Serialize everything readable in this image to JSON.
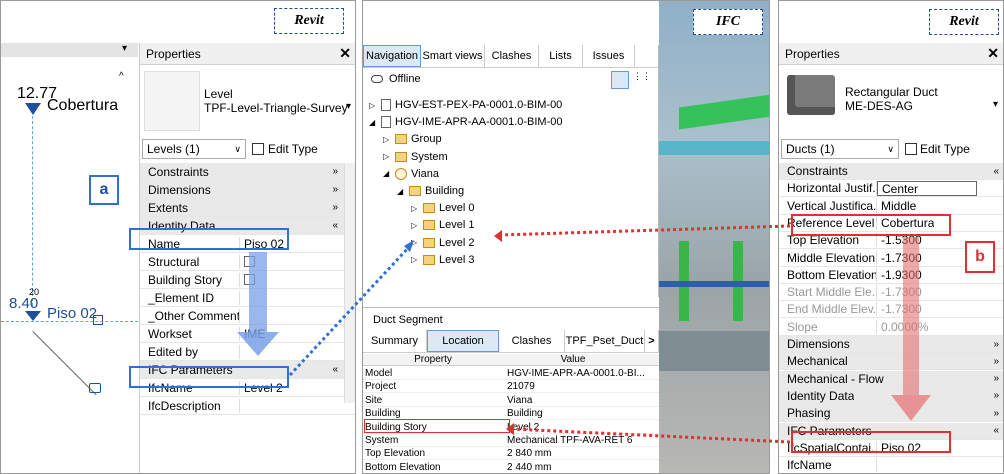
{
  "tags": {
    "left": "Revit",
    "middle": "IFC",
    "right": "Revit"
  },
  "left": {
    "elev_top_value": "12.77",
    "elev_top_name": "Cobertura",
    "elev_mid_value": "8.40",
    "elev_mid_name": "Piso 02",
    "elev_mid_small": "20",
    "callout_a": "a",
    "props_title": "Properties",
    "type_name_line1": "Level",
    "type_name_line2": "TPF-Level-Triangle-Survey",
    "filter": "Levels (1)",
    "edit_type": "Edit Type",
    "rows": [
      {
        "k": "Constraints",
        "v": "",
        "sec": true,
        "chev": "»"
      },
      {
        "k": "Dimensions",
        "v": "",
        "sec": true,
        "chev": "»"
      },
      {
        "k": "Extents",
        "v": "",
        "sec": true,
        "chev": "»"
      },
      {
        "k": "Identity Data",
        "v": "",
        "sec": true,
        "chev": "«"
      },
      {
        "k": "Name",
        "v": "Piso 02"
      },
      {
        "k": "Structural",
        "v": ""
      },
      {
        "k": "Building Story",
        "v": ""
      },
      {
        "k": "_Element ID",
        "v": ""
      },
      {
        "k": "_Other Comments",
        "v": ""
      },
      {
        "k": "Workset",
        "v": "IME"
      },
      {
        "k": "Edited by",
        "v": ""
      },
      {
        "k": "IFC Parameters",
        "v": "",
        "sec": true,
        "chev": "«"
      },
      {
        "k": "IfcName",
        "v": "Level 2"
      },
      {
        "k": "IfcDescription",
        "v": ""
      }
    ]
  },
  "middle": {
    "tabs": [
      "Navigation",
      "Smart views",
      "Clashes",
      "Lists",
      "Issues"
    ],
    "offline": "Offline",
    "tree": [
      {
        "label": "HGV-EST-PEX-PA-0001.0-BIM-00",
        "indent": 0,
        "arrow": "▷"
      },
      {
        "label": "HGV-IME-APR-AA-0001.0-BIM-00",
        "indent": 0,
        "arrow": "◢"
      },
      {
        "label": "Group",
        "indent": 1,
        "arrow": "▷"
      },
      {
        "label": "System",
        "indent": 1,
        "arrow": "▷"
      },
      {
        "label": "Viana",
        "indent": 1,
        "arrow": "◢"
      },
      {
        "label": "Building",
        "indent": 2,
        "arrow": "◢"
      },
      {
        "label": "Level 0",
        "indent": 3,
        "arrow": "▷"
      },
      {
        "label": "Level 1",
        "indent": 3,
        "arrow": "▷"
      },
      {
        "label": "Level 2",
        "indent": 3,
        "arrow": "▷"
      },
      {
        "label": "Level 3",
        "indent": 3,
        "arrow": "▷"
      }
    ],
    "duct_segment": "Duct Segment",
    "bottom_tabs": [
      "Summary",
      "Location",
      "Clashes",
      "TPF_Pset_Duct"
    ],
    "grid_headers": {
      "property": "Property",
      "value": "Value"
    },
    "grid_rows": [
      {
        "p": "Model",
        "v": "HGV-IME-APR-AA-0001.0-BI..."
      },
      {
        "p": "Project",
        "v": "21079"
      },
      {
        "p": "Site",
        "v": "Viana"
      },
      {
        "p": "Building",
        "v": "Building"
      },
      {
        "p": "Building Story",
        "v": "Level 2"
      },
      {
        "p": "System",
        "v": "Mechanical TPF-AVA-RET 6"
      },
      {
        "p": "Top Elevation",
        "v": "2 840 mm"
      },
      {
        "p": "Bottom Elevation",
        "v": "2 440 mm"
      }
    ]
  },
  "right": {
    "props_title": "Properties",
    "type_name_line1": "Rectangular Duct",
    "type_name_line2": "ME-DES-AG",
    "filter": "Ducts (1)",
    "edit_type": "Edit Type",
    "callout_b": "b",
    "rows": [
      {
        "k": "Constraints",
        "v": "",
        "sec": true,
        "chev": "«"
      },
      {
        "k": "Horizontal Justif...",
        "v": "Center"
      },
      {
        "k": "Vertical Justifica...",
        "v": "Middle"
      },
      {
        "k": "Reference Level",
        "v": "Cobertura"
      },
      {
        "k": "Top Elevation",
        "v": "-1.5300"
      },
      {
        "k": "Middle Elevation",
        "v": "-1.7300"
      },
      {
        "k": "Bottom Elevation",
        "v": "-1.9300"
      },
      {
        "k": "Start Middle Ele...",
        "v": "-1.7300",
        "dim": true
      },
      {
        "k": "End Middle Elev...",
        "v": "-1.7300",
        "dim": true
      },
      {
        "k": "Slope",
        "v": "0.0000%",
        "dim": true
      },
      {
        "k": "Dimensions",
        "v": "",
        "sec": true,
        "chev": "»"
      },
      {
        "k": "Mechanical",
        "v": "",
        "sec": true,
        "chev": "»"
      },
      {
        "k": "Mechanical - Flow",
        "v": "",
        "sec": true,
        "chev": "»"
      },
      {
        "k": "Identity Data",
        "v": "",
        "sec": true,
        "chev": "»"
      },
      {
        "k": "Phasing",
        "v": "",
        "sec": true,
        "chev": "»"
      },
      {
        "k": "IFC Parameters",
        "v": "",
        "sec": true,
        "chev": "«"
      },
      {
        "k": "IfcSpatialContai...",
        "v": "Piso 02"
      },
      {
        "k": "IfcName",
        "v": ""
      }
    ]
  }
}
